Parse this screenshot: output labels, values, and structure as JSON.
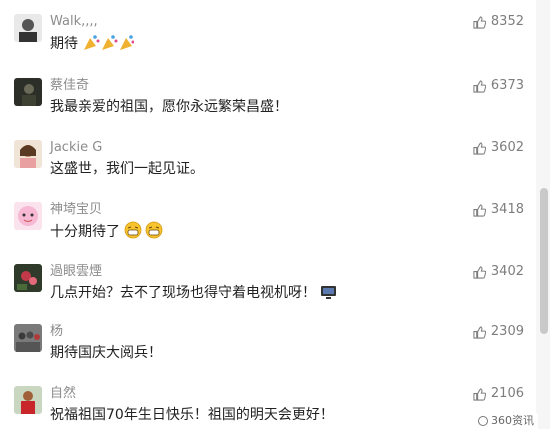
{
  "comments": [
    {
      "name": "Walk,,,,",
      "text": "期待",
      "likes": "8352",
      "avatar": "bw-portrait"
    },
    {
      "name": "蔡佳奇",
      "text": "我最亲爱的祖国，愿你永远繁荣昌盛！",
      "likes": "6373",
      "avatar": "dark-photo"
    },
    {
      "name": "Jackie G",
      "text": "这盛世，我们一起见证。",
      "likes": "3602",
      "avatar": "girl-photo"
    },
    {
      "name": "神埼宝贝",
      "text": "十分期待了",
      "likes": "3418",
      "avatar": "pink-cartoon"
    },
    {
      "name": "過眼雲煙",
      "text": "几点开始？去不了现场也得守着电视机呀！",
      "likes": "3402",
      "avatar": "flower-photo"
    },
    {
      "name": "杨",
      "text": "期待国庆大阅兵！",
      "likes": "2309",
      "avatar": "group-photo"
    },
    {
      "name": "自然",
      "text": "祝福祖国70年生日快乐！祖国的明天会更好！",
      "likes": "2106",
      "avatar": "red-photo"
    }
  ],
  "watermark": {
    "text": "360资讯"
  },
  "colors": {
    "name": "#8c8c8c",
    "text": "#222222",
    "likes": "#7d7d7d"
  }
}
